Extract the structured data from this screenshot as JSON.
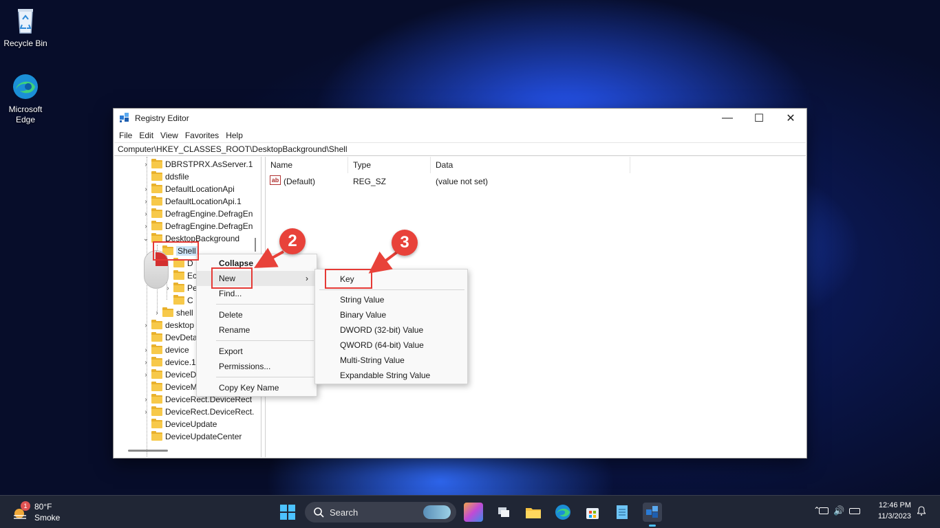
{
  "desktop": {
    "icons": [
      {
        "label_line1": "Recycle Bin",
        "label_line2": ""
      },
      {
        "label_line1": "Microsoft",
        "label_line2": "Edge"
      }
    ]
  },
  "window": {
    "title": "Registry Editor",
    "controls": {
      "minimize": "—",
      "maximize": "☐",
      "close": "✕"
    },
    "menu": [
      "File",
      "Edit",
      "View",
      "Favorites",
      "Help"
    ],
    "address": "Computer\\HKEY_CLASSES_ROOT\\DesktopBackground\\Shell"
  },
  "tree": {
    "rows": [
      {
        "label": "DBRSTPRX.AsServer.1",
        "expandable": true
      },
      {
        "label": "ddsfile",
        "expandable": false
      },
      {
        "label": "DefaultLocationApi",
        "expandable": true
      },
      {
        "label": "DefaultLocationApi.1",
        "expandable": true
      },
      {
        "label": "DefragEngine.DefragEn",
        "expandable": true
      },
      {
        "label": "DefragEngine.DefragEn",
        "expandable": true
      },
      {
        "label": "DesktopBackground",
        "expandable": true,
        "expanded": true
      },
      {
        "label": "Shell",
        "expandable": false,
        "selected": true
      },
      {
        "label": "D",
        "expandable": false
      },
      {
        "label": "Ec",
        "expandable": false
      },
      {
        "label": "Pe",
        "expandable": true
      },
      {
        "label": "C",
        "expandable": false
      },
      {
        "label": "shell",
        "expandable": true
      },
      {
        "label": "desktop",
        "expandable": true
      },
      {
        "label": "DevDeta",
        "expandable": false
      },
      {
        "label": "device",
        "expandable": true
      },
      {
        "label": "device.1",
        "expandable": true
      },
      {
        "label": "DeviceD",
        "expandable": true
      },
      {
        "label": "DeviceM",
        "expandable": false
      },
      {
        "label": "DeviceRect.DeviceRect",
        "expandable": true
      },
      {
        "label": "DeviceRect.DeviceRect.",
        "expandable": true
      },
      {
        "label": "DeviceUpdate",
        "expandable": false
      },
      {
        "label": "DeviceUpdateCenter",
        "expandable": false
      }
    ]
  },
  "values": {
    "columns": [
      "Name",
      "Type",
      "Data"
    ],
    "rows": [
      {
        "icon": "ab",
        "name": "(Default)",
        "type": "REG_SZ",
        "data": "(value not set)"
      }
    ]
  },
  "context_menu": {
    "collapse": "Collapse",
    "new": "New",
    "find": "Find...",
    "delete": "Delete",
    "rename": "Rename",
    "export": "Export",
    "permissions": "Permissions...",
    "copy_key_name": "Copy Key Name",
    "submenu_arrow": "›"
  },
  "new_submenu": {
    "key": "Key",
    "string": "String Value",
    "binary": "Binary Value",
    "dword": "DWORD (32-bit) Value",
    "qword": "QWORD (64-bit) Value",
    "multi": "Multi-String Value",
    "expandable": "Expandable String Value"
  },
  "annotations": {
    "step2": "2",
    "step3": "3",
    "color": "#e8423a"
  },
  "taskbar": {
    "weather": {
      "temp": "80°F",
      "condition": "Smoke",
      "alert": "1"
    },
    "search_label": "Search",
    "time": "12:46 PM",
    "date": "11/3/2023"
  }
}
